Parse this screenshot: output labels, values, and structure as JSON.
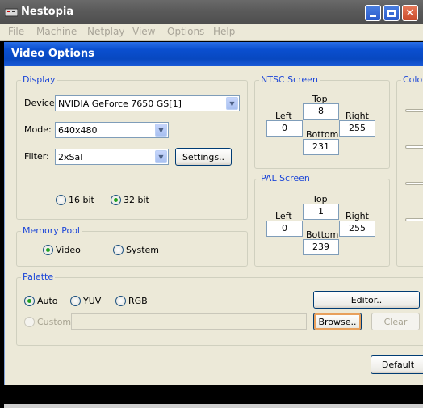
{
  "window": {
    "title": "Nestopia"
  },
  "menu": [
    "File",
    "Machine",
    "Netplay",
    "View",
    "Options",
    "Help"
  ],
  "dialog": {
    "title": "Video Options",
    "display": {
      "group_title": "Display",
      "device_label": "Device:",
      "device_value": "NVIDIA GeForce 7650 GS[1]",
      "mode_label": "Mode:",
      "mode_value": "640x480",
      "filter_label": "Filter:",
      "filter_value": "2xSaI",
      "settings_label": "Settings..",
      "bit16_label": "16 bit",
      "bit32_label": "32 bit"
    },
    "memory_pool": {
      "group_title": "Memory Pool",
      "video_label": "Video",
      "system_label": "System"
    },
    "ntsc": {
      "group_title": "NTSC Screen",
      "top_label": "Top",
      "top_value": "8",
      "left_label": "Left",
      "left_value": "0",
      "right_label": "Right",
      "right_value": "255",
      "bottom_label": "Bottom",
      "bottom_value": "231"
    },
    "pal": {
      "group_title": "PAL Screen",
      "top_label": "Top",
      "top_value": "1",
      "left_label": "Left",
      "left_value": "0",
      "right_label": "Right",
      "right_value": "255",
      "bottom_label": "Bottom",
      "bottom_value": "239"
    },
    "color": {
      "group_title": "Color"
    },
    "palette": {
      "group_title": "Palette",
      "auto_label": "Auto",
      "yuv_label": "YUV",
      "rgb_label": "RGB",
      "custom_label": "Custom",
      "editor_label": "Editor..",
      "browse_label": "Browse..",
      "clear_label": "Clear"
    },
    "default_label": "Default"
  }
}
